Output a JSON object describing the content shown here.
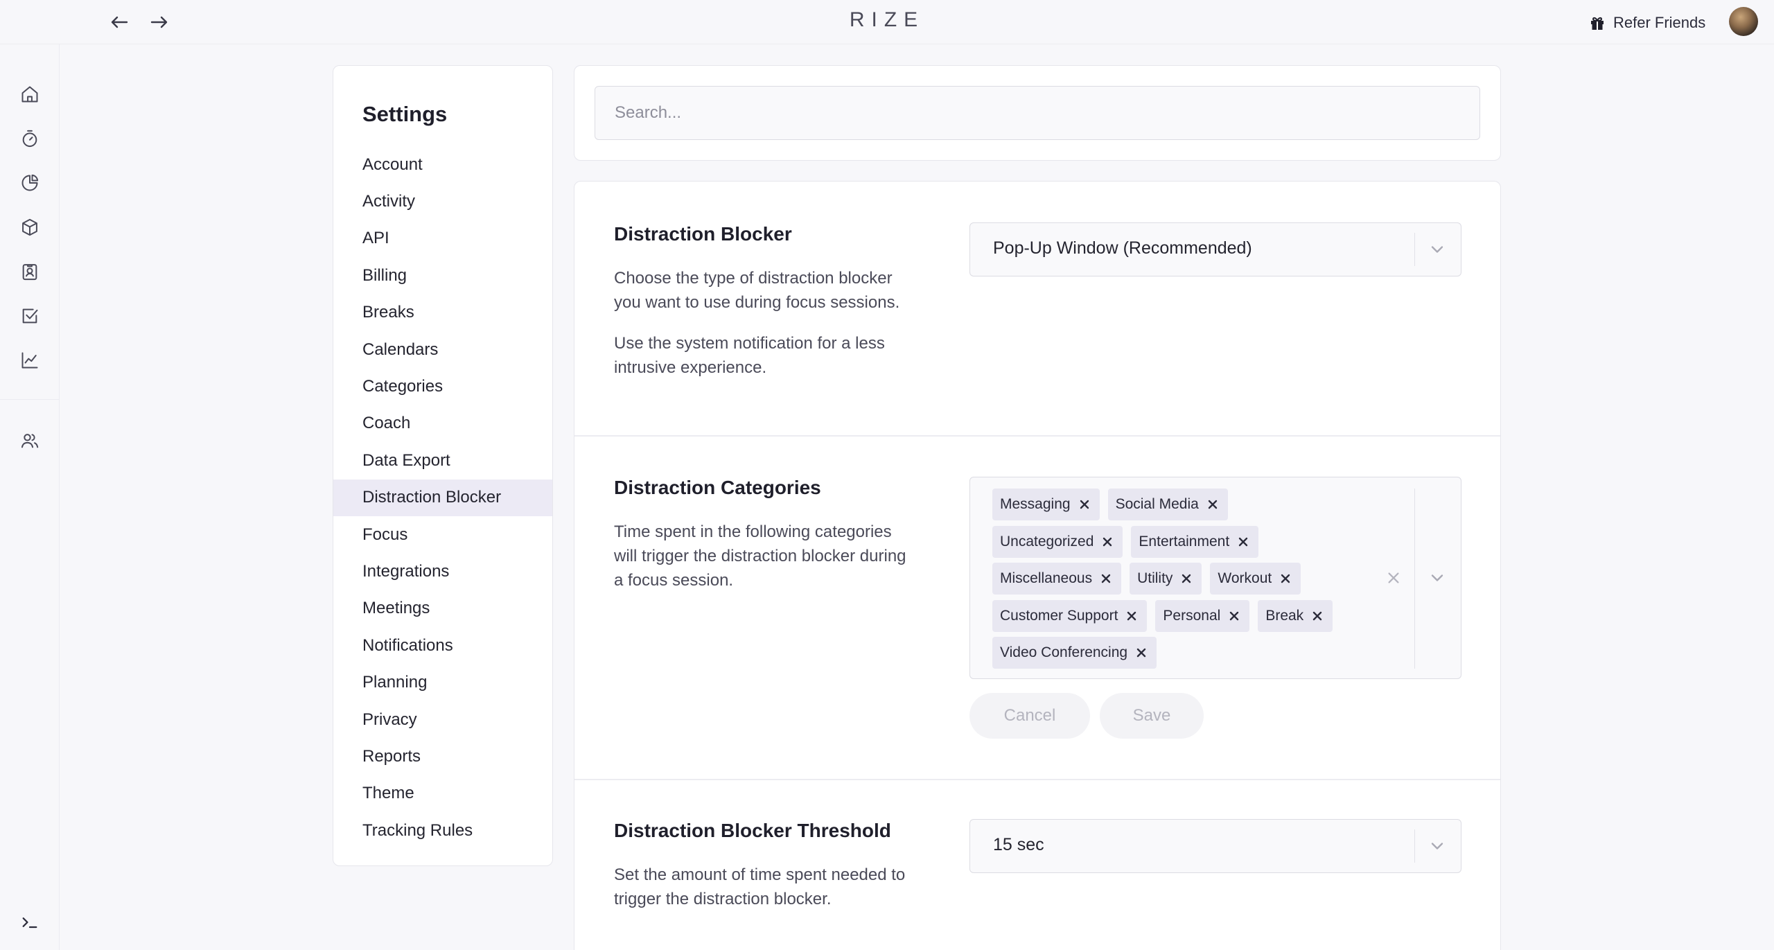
{
  "app": {
    "brand": "RIZE"
  },
  "topbar": {
    "back_icon": "arrow-left-icon",
    "forward_icon": "arrow-right-icon",
    "refer_label": "Refer Friends",
    "refer_icon": "gift-icon"
  },
  "rail": {
    "items": [
      {
        "icon": "home-icon"
      },
      {
        "icon": "timer-icon"
      },
      {
        "icon": "pie-chart-icon"
      },
      {
        "icon": "cube-icon"
      },
      {
        "icon": "contact-badge-icon"
      },
      {
        "icon": "checkbox-icon"
      },
      {
        "icon": "line-chart-icon"
      },
      {
        "icon": "users-icon"
      }
    ],
    "bottom_icon": "terminal-icon"
  },
  "settings": {
    "title": "Settings",
    "items": [
      "Account",
      "Activity",
      "API",
      "Billing",
      "Breaks",
      "Calendars",
      "Categories",
      "Coach",
      "Data Export",
      "Distraction Blocker",
      "Focus",
      "Integrations",
      "Meetings",
      "Notifications",
      "Planning",
      "Privacy",
      "Reports",
      "Theme",
      "Tracking Rules"
    ],
    "active": "Distraction Blocker"
  },
  "search": {
    "placeholder": "Search..."
  },
  "blocker": {
    "title": "Distraction Blocker",
    "desc1": "Choose the type of distraction blocker you want to use during focus sessions.",
    "desc2": "Use the system notification for a less intrusive experience.",
    "selected": "Pop-Up Window (Recommended)"
  },
  "categories": {
    "title": "Distraction Categories",
    "desc": "Time spent in the following categories will trigger the distraction blocker during a focus session.",
    "chips": [
      [
        "Messaging",
        "Social Media"
      ],
      [
        "Uncategorized",
        "Entertainment"
      ],
      [
        "Miscellaneous",
        "Utility",
        "Workout"
      ],
      [
        "Customer Support",
        "Personal",
        "Break"
      ],
      [
        "Video Conferencing"
      ]
    ],
    "cancel_label": "Cancel",
    "save_label": "Save"
  },
  "threshold": {
    "title": "Distraction Blocker Threshold",
    "desc": "Set the amount of time spent needed to trigger the distraction blocker.",
    "selected": "15 sec"
  }
}
